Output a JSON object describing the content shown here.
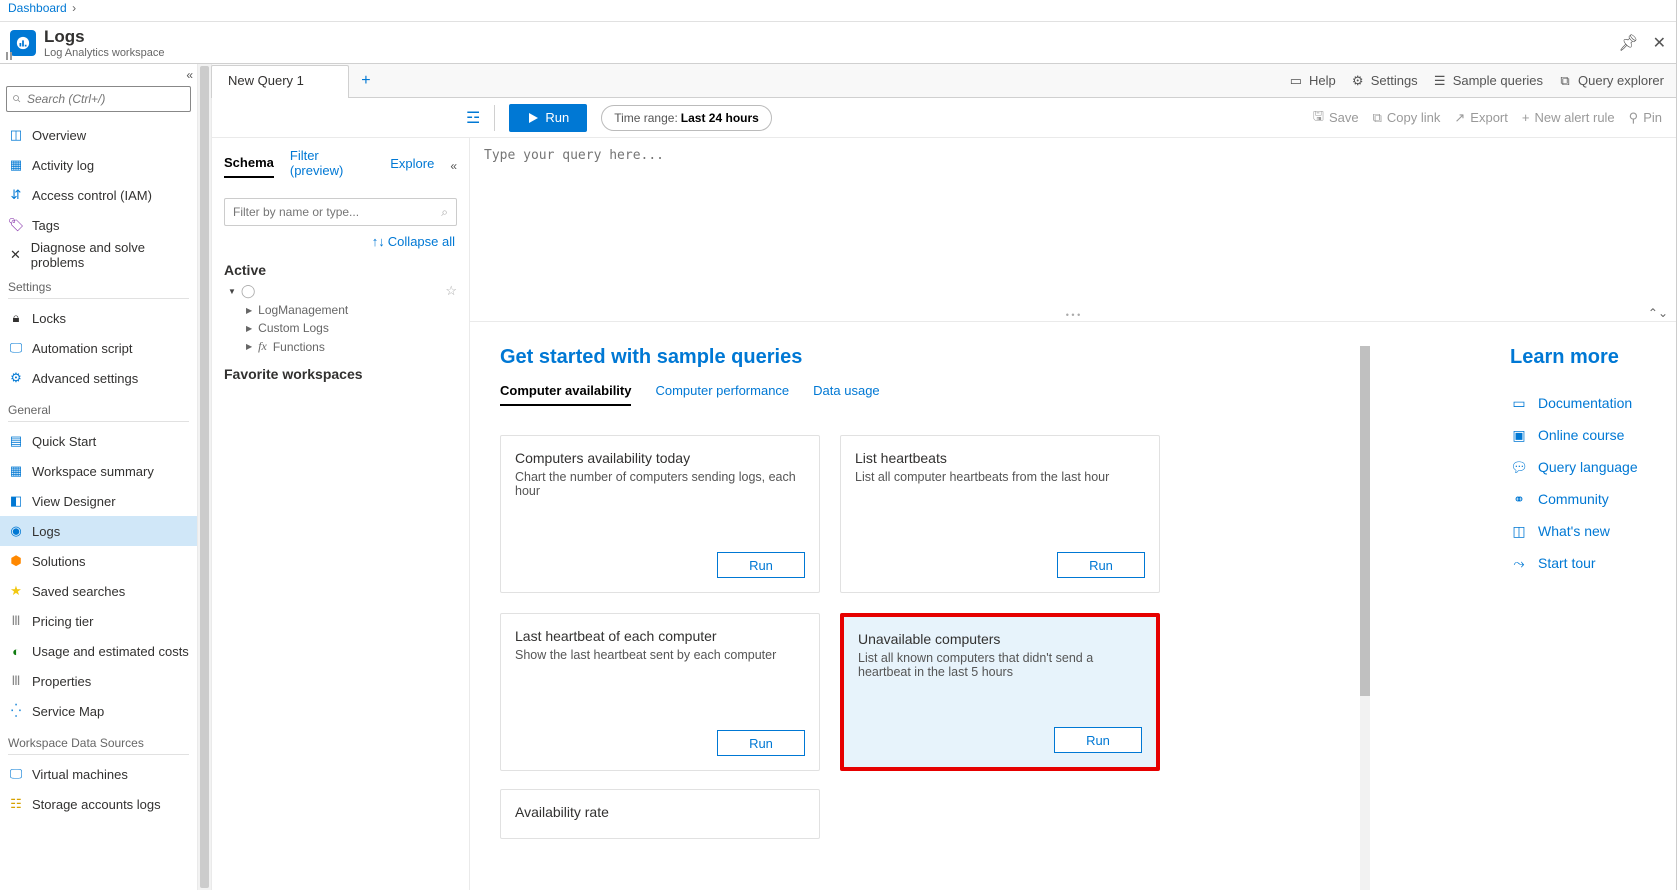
{
  "breadcrumb": {
    "root": "Dashboard"
  },
  "header": {
    "title": "Logs",
    "subtitle": "Log Analytics workspace"
  },
  "sidebar": {
    "search_placeholder": "Search (Ctrl+/)",
    "items_top": [
      {
        "icon": "overview",
        "label": "Overview"
      },
      {
        "icon": "activity",
        "label": "Activity log"
      },
      {
        "icon": "iam",
        "label": "Access control (IAM)"
      },
      {
        "icon": "tags",
        "label": "Tags"
      },
      {
        "icon": "diagnose",
        "label": "Diagnose and solve problems"
      }
    ],
    "section_settings": "Settings",
    "items_settings": [
      {
        "icon": "locks",
        "label": "Locks"
      },
      {
        "icon": "automation",
        "label": "Automation script"
      },
      {
        "icon": "adv",
        "label": "Advanced settings"
      }
    ],
    "section_general": "General",
    "items_general": [
      {
        "icon": "quick",
        "label": "Quick Start"
      },
      {
        "icon": "summary",
        "label": "Workspace summary"
      },
      {
        "icon": "designer",
        "label": "View Designer"
      },
      {
        "icon": "logs",
        "label": "Logs",
        "selected": true
      },
      {
        "icon": "solutions",
        "label": "Solutions"
      },
      {
        "icon": "saved",
        "label": "Saved searches"
      },
      {
        "icon": "pricing",
        "label": "Pricing tier"
      },
      {
        "icon": "usage",
        "label": "Usage and estimated costs"
      },
      {
        "icon": "props",
        "label": "Properties"
      },
      {
        "icon": "svcmap",
        "label": "Service Map"
      }
    ],
    "section_wds": "Workspace Data Sources",
    "items_wds": [
      {
        "icon": "vm",
        "label": "Virtual machines"
      },
      {
        "icon": "storage",
        "label": "Storage accounts logs"
      }
    ]
  },
  "tabs": {
    "active": "New Query 1"
  },
  "tabbar_actions": {
    "help": "Help",
    "settings": "Settings",
    "sample": "Sample queries",
    "explorer": "Query explorer"
  },
  "toolbar": {
    "run": "Run",
    "time_label": "Time range:",
    "time_value": "Last 24 hours",
    "disabled": {
      "save": "Save",
      "copy": "Copy link",
      "export": "Export",
      "alert": "New alert rule",
      "pin": "Pin"
    }
  },
  "schema": {
    "tabs": {
      "schema": "Schema",
      "filter": "Filter (preview)",
      "explore": "Explore"
    },
    "filter_placeholder": "Filter by name or type...",
    "collapse_all": "Collapse all",
    "active": "Active",
    "nodes": [
      "LogManagement",
      "Custom Logs",
      "Functions"
    ],
    "favorite": "Favorite workspaces"
  },
  "editor": {
    "placeholder": "Type your query here..."
  },
  "samples": {
    "title": "Get started with sample queries",
    "tabs": {
      "availability": "Computer availability",
      "performance": "Computer performance",
      "usage": "Data usage"
    },
    "cards": [
      {
        "title": "Computers availability today",
        "desc": "Chart the number of computers sending logs, each hour",
        "run": "Run"
      },
      {
        "title": "List heartbeats",
        "desc": "List all computer heartbeats from the last hour",
        "run": "Run"
      },
      {
        "title": "Last heartbeat of each computer",
        "desc": "Show the last heartbeat sent by each computer",
        "run": "Run"
      },
      {
        "title": "Unavailable computers",
        "desc": "List all known computers that didn't send a heartbeat in the last 5 hours",
        "run": "Run",
        "highlight": true
      },
      {
        "title": "Availability rate",
        "desc": "",
        "run": ""
      }
    ]
  },
  "learn": {
    "title": "Learn more",
    "links": [
      {
        "icon": "doc",
        "label": "Documentation"
      },
      {
        "icon": "course",
        "label": "Online course"
      },
      {
        "icon": "lang",
        "label": "Query language"
      },
      {
        "icon": "community",
        "label": "Community"
      },
      {
        "icon": "whatsnew",
        "label": "What's new"
      },
      {
        "icon": "tour",
        "label": "Start tour"
      }
    ]
  }
}
